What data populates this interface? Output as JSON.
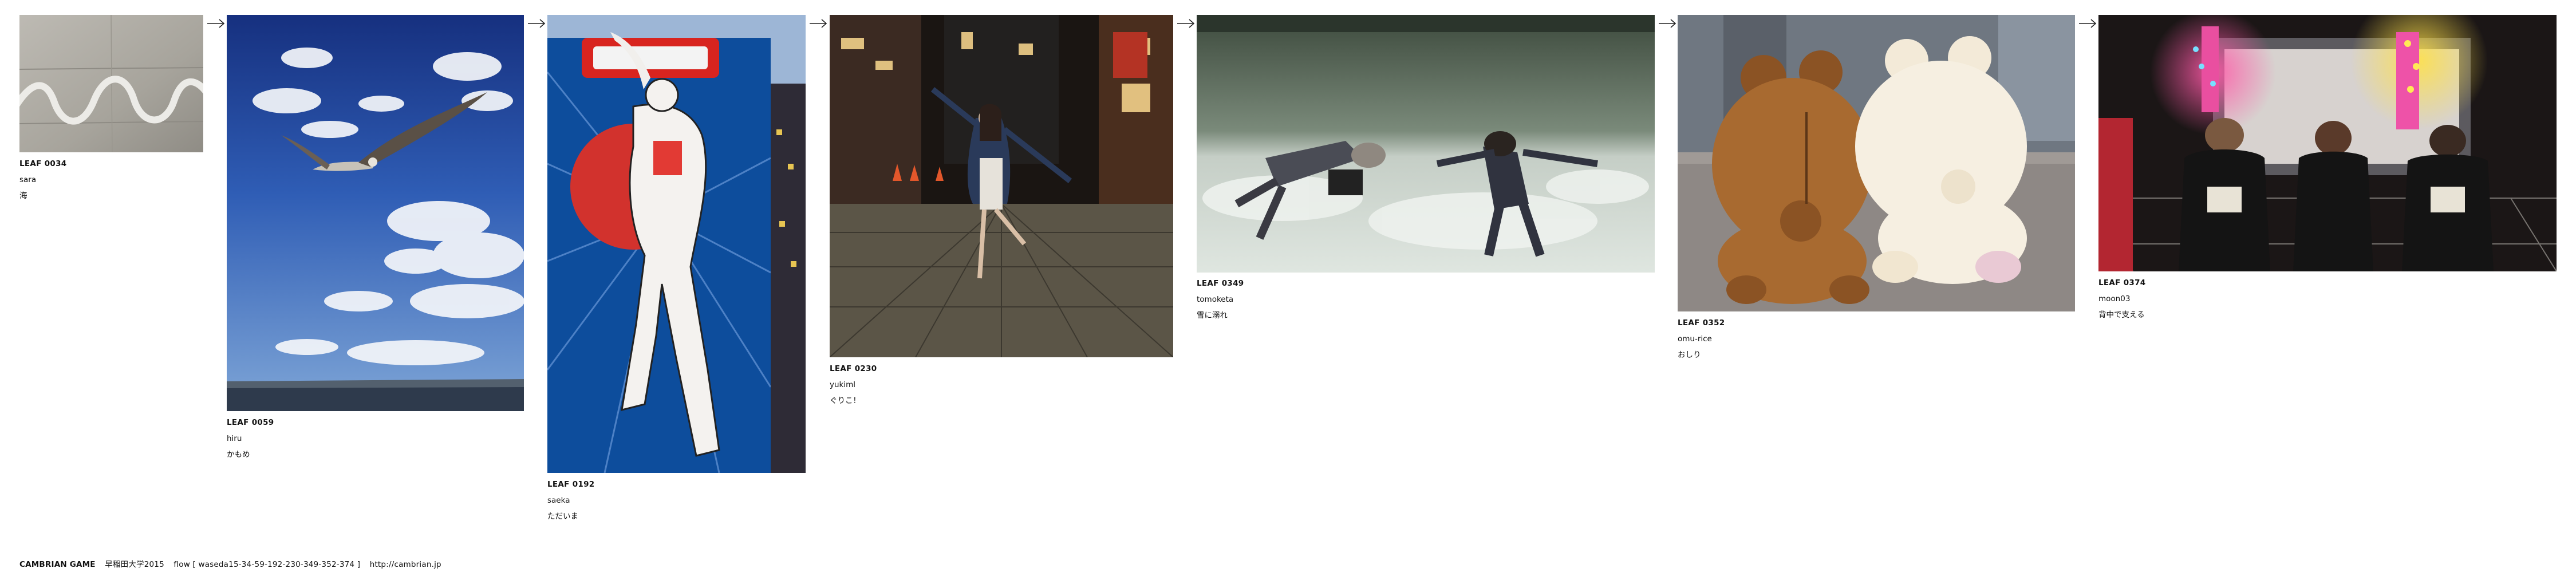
{
  "leaves": [
    {
      "id": "LEAF 0034",
      "user": "sara",
      "caption": "海"
    },
    {
      "id": "LEAF 0059",
      "user": "hiru",
      "caption": "かもめ"
    },
    {
      "id": "LEAF 0192",
      "user": "saeka",
      "caption": "ただいま"
    },
    {
      "id": "LEAF 0230",
      "user": "yukiml",
      "caption": "ぐりこ！"
    },
    {
      "id": "LEAF 0349",
      "user": "tomoketa",
      "caption": "雪に溺れ"
    },
    {
      "id": "LEAF 0352",
      "user": "omu-rice",
      "caption": "おしり"
    },
    {
      "id": "LEAF 0374",
      "user": "moon03",
      "caption": "背中で支える"
    }
  ],
  "footer": {
    "brand": "CAMBRIAN GAME",
    "event": "早稲田大学2015",
    "flow": "flow [ waseda15-34-59-192-230-349-352-374 ]",
    "url": "http://cambrian.jp"
  },
  "colors": {
    "text": "#111111",
    "background": "#ffffff",
    "arrow": "#222222"
  }
}
